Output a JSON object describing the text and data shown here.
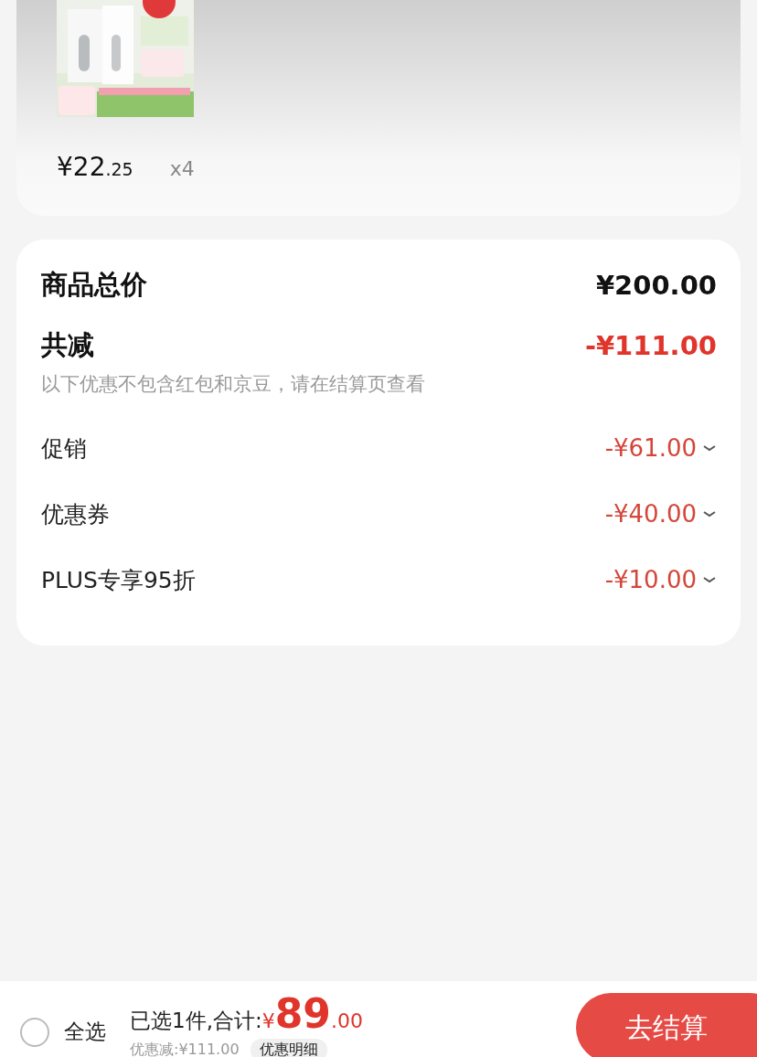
{
  "product": {
    "price": {
      "integer": "¥22",
      "decimal": ".25"
    },
    "quantity": "x4"
  },
  "summary": {
    "total_label": "商品总价",
    "total_value": "¥200.00",
    "discount_label": "共减",
    "discount_value": "-¥111.00",
    "note": "以下优惠不包含红包和京豆，请在结算页查看",
    "rows": [
      {
        "label": "促销",
        "amount": "-¥61.00"
      },
      {
        "label": "优惠券",
        "amount": "-¥40.00"
      },
      {
        "label": "PLUS专享95折",
        "amount": "-¥10.00"
      }
    ]
  },
  "bottom_bar": {
    "select_all": {
      "label": "全选",
      "checked": false
    },
    "selected_text": "已选1件,合计:",
    "total": {
      "currency": "¥",
      "integer": "89",
      "decimal": ".00"
    },
    "discount_text": "优惠减:¥111.00",
    "detail_button": "优惠明细",
    "checkout_button": "去结算"
  }
}
